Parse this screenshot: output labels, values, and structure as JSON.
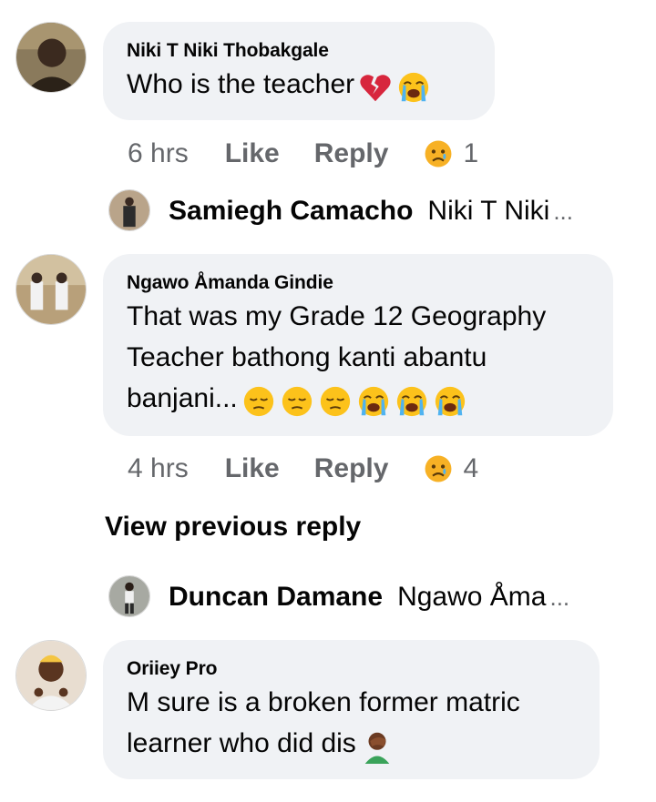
{
  "comments": [
    {
      "author": "Niki T Niki Thobakgale",
      "text": "Who is the teacher",
      "emojis": [
        "broken-heart",
        "loudly-crying"
      ],
      "time": "6 hrs",
      "like": "Like",
      "reply": "Reply",
      "reaction_count": "1"
    },
    {
      "author": "Ngawo Åmanda Gindie",
      "text_lines": [
        "That was my Grade 12 Geography",
        "Teacher bathong kanti abantu",
        "banjani..."
      ],
      "emojis": [
        "pensive",
        "pensive",
        "pensive",
        "loudly-crying",
        "loudly-crying",
        "loudly-crying"
      ],
      "time": "4 hrs",
      "like": "Like",
      "reply": "Reply",
      "reaction_count": "4"
    },
    {
      "author": "Oriiey Pro",
      "text_lines": [
        "M sure is a broken former matric",
        "learner who did dis"
      ],
      "emojis": [
        "facepalm"
      ]
    }
  ],
  "replies": [
    {
      "author": "Samiegh Camacho",
      "preview": "Niki T Niki",
      "ellipsis": "..."
    },
    {
      "author": "Duncan Damane",
      "preview": "Ngawo Åma",
      "ellipsis": "..."
    }
  ],
  "view_previous": "View previous reply",
  "colors": {
    "bubble": "#f0f2f5",
    "meta": "#65676b",
    "text": "#050505"
  }
}
